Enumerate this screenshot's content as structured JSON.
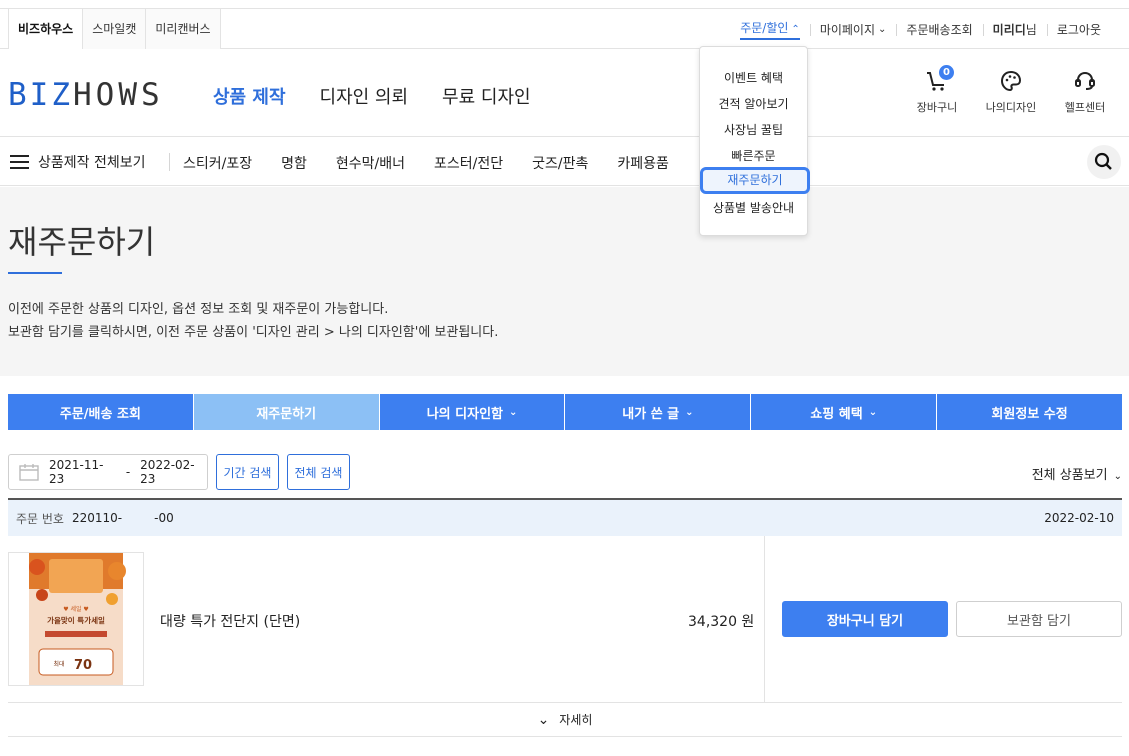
{
  "sites": [
    "비즈하우스",
    "스마일캣",
    "미리캔버스"
  ],
  "utils": {
    "order_discount": "주문/할인",
    "mypage": "마이페이지",
    "order_tracking": "주문배송조회",
    "user_name": "미리디",
    "user_suffix": "님",
    "logout": "로그아웃"
  },
  "logo": {
    "part1": "BIZ",
    "part2": "HOWS"
  },
  "main_nav": [
    "상품 제작",
    "디자인 의뢰",
    "무료 디자인"
  ],
  "header_icons": {
    "cart_label": "장바구니",
    "cart_count": "0",
    "mydesign_label": "나의디자인",
    "help_label": "헬프센터"
  },
  "category_bar": {
    "all_label": "상품제작 전체보기",
    "items": [
      "스티커/포장",
      "명함",
      "현수막/배너",
      "포스터/전단",
      "굿즈/판촉",
      "카페용품"
    ]
  },
  "dropdown": [
    "이벤트 혜택",
    "견적 알아보기",
    "사장님 꿀팁",
    "빠른주문",
    "재주문하기",
    "상품별 발송안내"
  ],
  "page": {
    "title": "재주문하기",
    "desc1": "이전에 주문한 상품의 디자인, 옵션 정보 조회 및 재주문이 가능합니다.",
    "desc2": "보관함 담기를 클릭하시면, 이전 주문 상품이 '디자인 관리 > 나의 디자인함'에 보관됩니다."
  },
  "tabs": [
    "주문/배송 조회",
    "재주문하기",
    "나의 디자인함",
    "내가 쓴 글",
    "쇼핑 혜택",
    "회원정보 수정"
  ],
  "filter": {
    "date_from": "2021-11-23",
    "date_sep": "-",
    "date_to": "2022-02-23",
    "period_search": "기간 검색",
    "all_search": "전체 검색",
    "view_all": "전체 상품보기"
  },
  "order": {
    "number_label": "주문 번호",
    "number": "220110-",
    "number_tail": "-00",
    "date": "2022-02-10",
    "product_name": "대량 특가 전단지 (단면)",
    "price": "34,320 원",
    "add_cart": "장바구니 담기",
    "keep": "보관함 담기",
    "detail": "자세히"
  },
  "thumb_text": {
    "line1": "♥ 세일 ♥",
    "line2": "가을맞이 특가세일",
    "line3": "최대",
    "line4": "70"
  },
  "colors": {
    "accent": "#3d7ff0",
    "tab_active": "#8cc0f5",
    "hero_bg": "#f5f5f5"
  }
}
